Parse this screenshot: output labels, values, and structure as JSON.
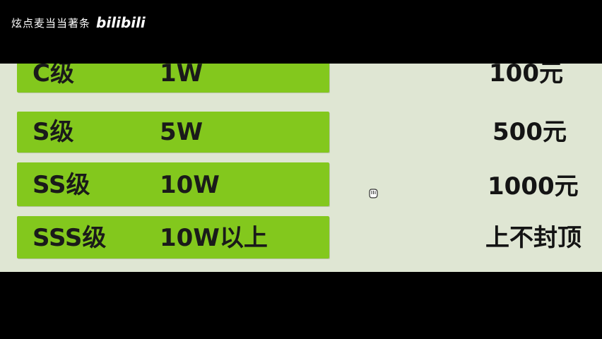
{
  "watermark": {
    "channel": "炫点麦当当著条",
    "platform_logo": "bilibili"
  },
  "tiers": [
    {
      "level": "C级",
      "count": "1W",
      "reward": "100元"
    },
    {
      "level": "S级",
      "count": "5W",
      "reward": "500元"
    },
    {
      "level": "SS级",
      "count": "10W",
      "reward": "1000元"
    },
    {
      "level": "SSS级",
      "count": "10W以上",
      "reward": "上不封顶"
    }
  ],
  "colors": {
    "bar_green": "#83c81d",
    "panel_bg": "#dfe6d3",
    "letterbox": "#000000"
  },
  "icons": {
    "cursor": "hand-cursor-icon"
  }
}
